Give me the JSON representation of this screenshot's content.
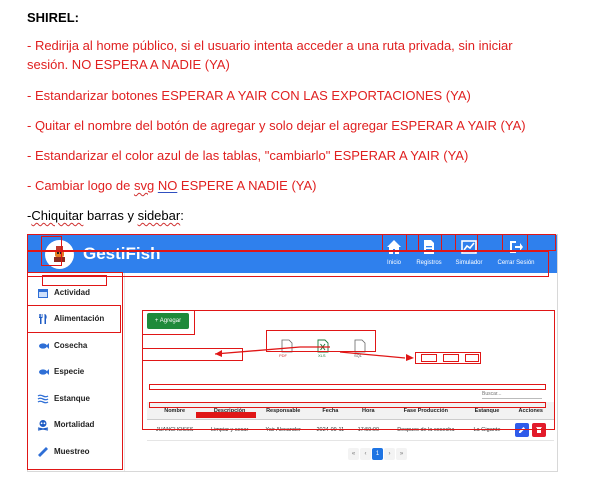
{
  "doc": {
    "heading": "SHIREL:",
    "items": [
      "- Redirija al home público, si el usuario intenta acceder a una ruta privada, sin iniciar",
      "sesión. NO ESPERA A NADIE (YA)",
      "- Estandarizar botones ESPERAR A YAIR CON LAS EXPORTACIONES (YA)",
      "- Quitar el nombre del botón de agregar y solo dejar el agregar ESPERAR A YAIR (YA)",
      "- Estandarizar el color azul de las tablas, \"cambiarlo\" ESPERAR A YAIR (YA)"
    ],
    "logo_item": {
      "a": "- Cambiar logo de ",
      "b": "svg",
      "c": " ",
      "d": "NO",
      "e": " ESPERE A NADIE (YA)"
    },
    "last_item": {
      "a": "-",
      "b": "Chiquitar",
      "c": " barras y ",
      "d": "sidebar",
      "e": ":"
    }
  },
  "app": {
    "brand": "GestiFish",
    "nav": [
      {
        "label": "Inicio",
        "icon": "home-icon"
      },
      {
        "label": "Registros",
        "icon": "document-icon"
      },
      {
        "label": "Simulador",
        "icon": "chart-icon"
      },
      {
        "label": "Cerrar Sesión",
        "icon": "logout-icon"
      }
    ],
    "sidebar": [
      {
        "label": "Actividad",
        "icon": "calendar-icon"
      },
      {
        "label": "Alimentación",
        "icon": "utensils-icon"
      },
      {
        "label": "Cosecha",
        "icon": "fish-icon"
      },
      {
        "label": "Especie",
        "icon": "fish-icon"
      },
      {
        "label": "Estanque",
        "icon": "water-icon"
      },
      {
        "label": "Mortalidad",
        "icon": "skull-icon"
      },
      {
        "label": "Muestreo",
        "icon": "ruler-icon"
      }
    ],
    "add_button": "+ Agregar",
    "exports": [
      "PDF",
      "XLS",
      "SQL"
    ],
    "search_placeholder": "Buscar...",
    "table": {
      "headers": [
        "Nombre",
        "Descripción",
        "Responsable",
        "Fecha",
        "Hora",
        "Fase Producción",
        "Estanque",
        "Acciones"
      ],
      "rows": [
        [
          "JUANCHOSSS",
          "Limpiar y secar",
          "Yair Alexander",
          "2024-09-11",
          "17:59:00",
          "Despues de la cosecha",
          "La Gigante"
        ]
      ]
    },
    "pagination": {
      "prev": "«",
      "prev2": "‹",
      "current": "1",
      "next": "›",
      "next2": "»"
    }
  },
  "colors": {
    "annotation": "#e01616",
    "primary": "#2f80ed",
    "add": "#1e8a3a",
    "text_red": "#e02020"
  }
}
